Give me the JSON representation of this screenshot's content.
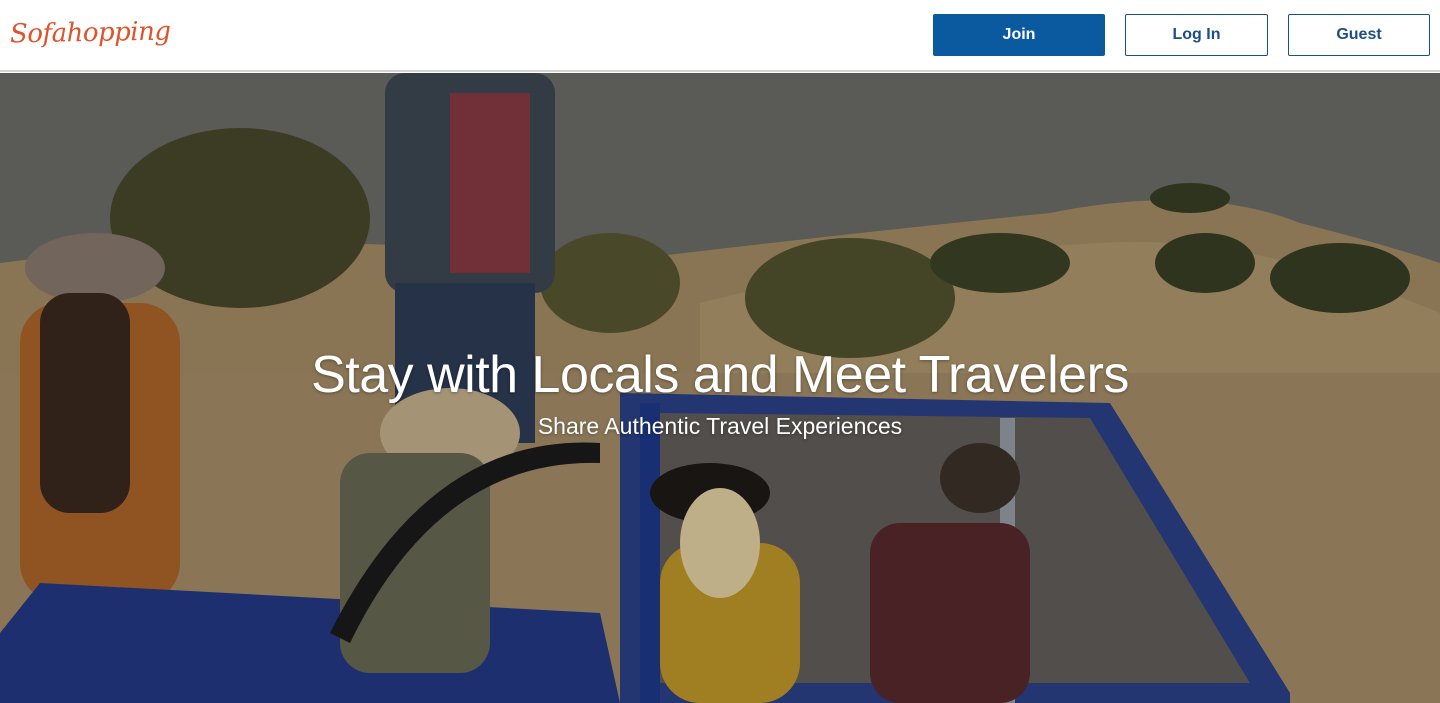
{
  "header": {
    "logo_text": "Sofahopping",
    "join_label": "Join",
    "login_label": "Log In",
    "guest_label": "Guest"
  },
  "hero": {
    "headline": "Stay with Locals and Meet Travelers",
    "subheadline": "Share Authentic Travel Experiences"
  },
  "colors": {
    "brand_logo": "#e0522a",
    "primary_button": "#0b5aa0",
    "outline_button_text": "#1b4f86"
  }
}
